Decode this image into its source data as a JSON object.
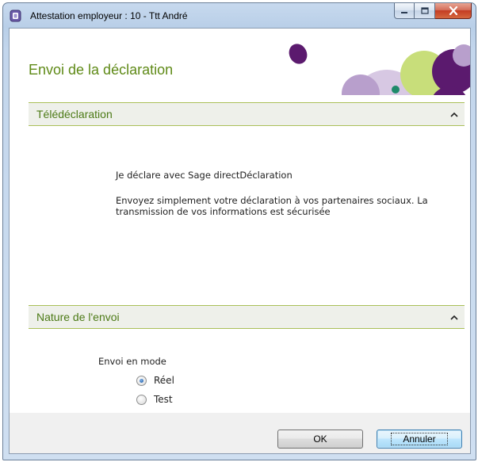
{
  "window": {
    "title": "Attestation employeur : 10 - Ttt André"
  },
  "header": {
    "title": "Envoi de la déclaration"
  },
  "sections": {
    "teledeclaration": {
      "title": "Télédéclaration",
      "line1": "Je déclare avec Sage directDéclaration",
      "line2": "Envoyez simplement votre déclaration à vos partenaires sociaux. La transmission de vos informations est sécurisée"
    },
    "nature": {
      "title": "Nature de l'envoi",
      "mode_label": "Envoi en mode",
      "options": [
        {
          "label": "Réel",
          "selected": true
        },
        {
          "label": "Test",
          "selected": false
        }
      ]
    }
  },
  "buttons": {
    "ok": "OK",
    "cancel": "Annuler"
  },
  "colors": {
    "accent_green": "#5f8a17",
    "section_border": "#aabf58",
    "deco_purple": "#5b1a6e",
    "deco_lilac": "#b89fcc",
    "deco_lime": "#c8de7a",
    "deco_teal": "#1e8a6a"
  }
}
